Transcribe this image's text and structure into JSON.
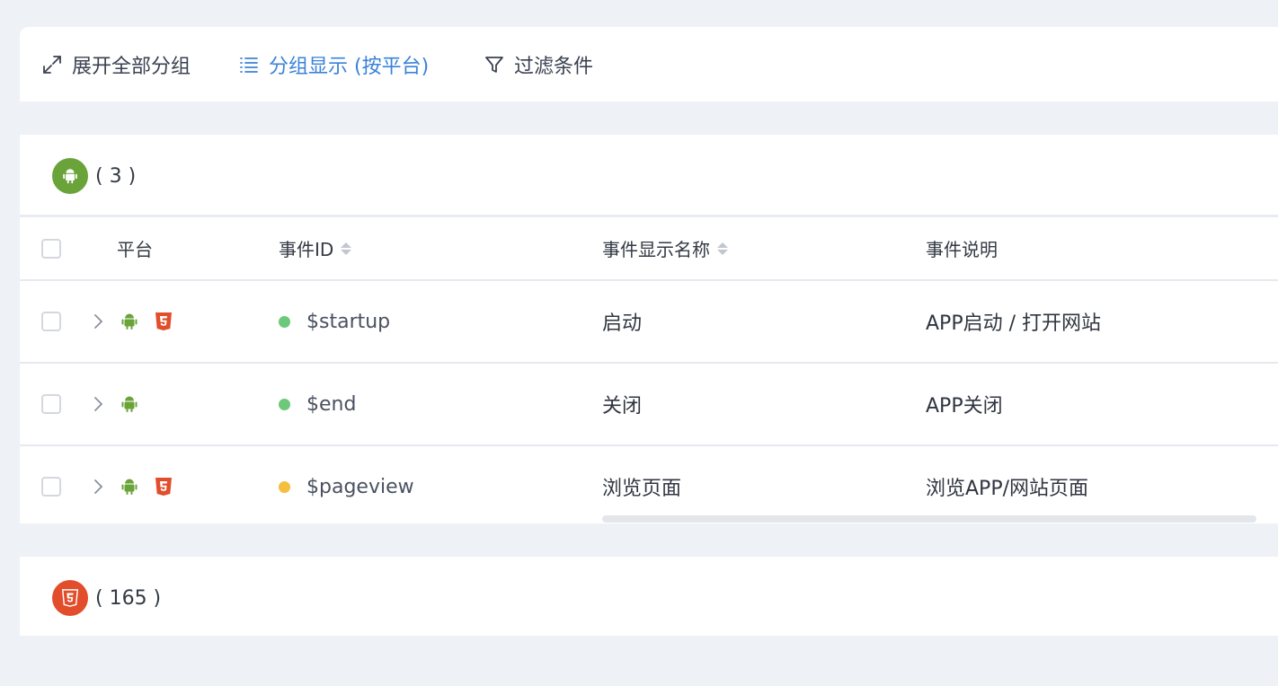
{
  "toolbar": {
    "expand_label": "展开全部分组",
    "group_label": "分组显示 (按平台)",
    "filter_label": "过滤条件"
  },
  "groups": [
    {
      "platform": "android",
      "count_label": "( 3 )"
    },
    {
      "platform": "html5",
      "count_label": "( 165 )"
    }
  ],
  "table": {
    "columns": [
      "平台",
      "事件ID",
      "事件显示名称",
      "事件说明"
    ],
    "rows": [
      {
        "event_id": "$startup",
        "display_name": "启动",
        "description": "APP启动 / 打开网站",
        "platforms": [
          "android",
          "html5"
        ],
        "status_color": "#6cc97a"
      },
      {
        "event_id": "$end",
        "display_name": "关闭",
        "description": "APP关闭",
        "platforms": [
          "android"
        ],
        "status_color": "#6cc97a"
      },
      {
        "event_id": "$pageview",
        "display_name": "浏览页面",
        "description": "浏览APP/网站页面",
        "platforms": [
          "android",
          "html5"
        ],
        "status_color": "#f3bf3d"
      }
    ]
  },
  "colors": {
    "accent": "#3b82d8",
    "android": "#6aa339",
    "html5": "#e24d2b"
  }
}
